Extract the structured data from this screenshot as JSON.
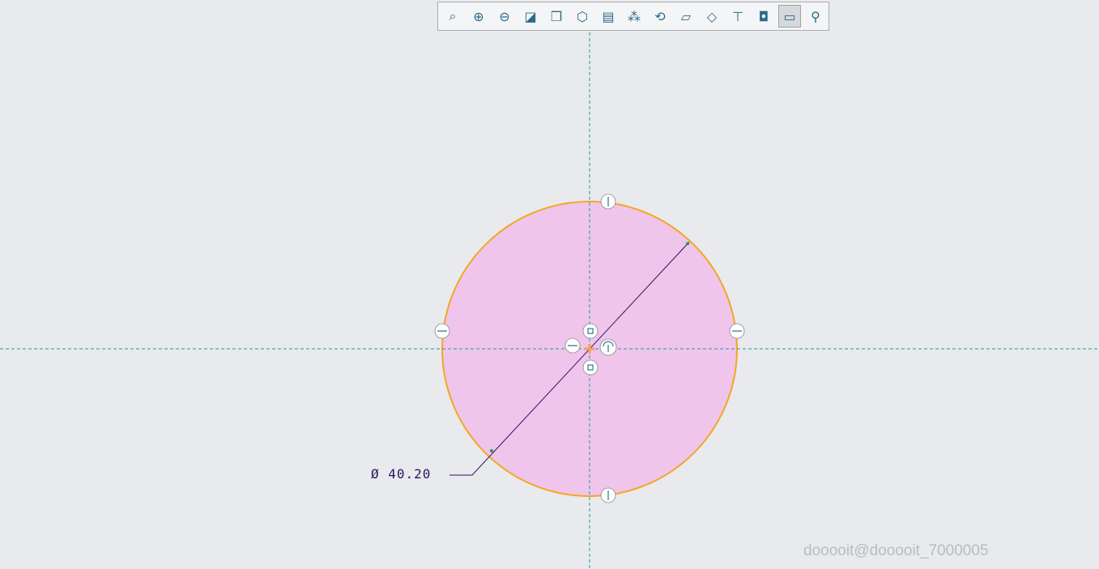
{
  "toolbar": {
    "items": [
      {
        "name": "refit-icon",
        "glyph": "⌕"
      },
      {
        "name": "zoom-in-icon",
        "glyph": "⊕"
      },
      {
        "name": "zoom-out-icon",
        "glyph": "⊖"
      },
      {
        "name": "repaint-icon",
        "glyph": "◪"
      },
      {
        "name": "display-style-icon",
        "glyph": "❒"
      },
      {
        "name": "saved-orientations-icon",
        "glyph": "⬡"
      },
      {
        "name": "view-manager-icon",
        "glyph": "▤"
      },
      {
        "name": "datum-display-icon",
        "glyph": "⁂"
      },
      {
        "name": "spin-center-icon",
        "glyph": "⟲"
      },
      {
        "name": "shaded-icon",
        "glyph": "▱"
      },
      {
        "name": "wireframe-icon",
        "glyph": "◇"
      },
      {
        "name": "annotation-display-icon",
        "glyph": "⊤"
      },
      {
        "name": "sketch-display-icon",
        "glyph": "◘"
      },
      {
        "name": "sketch-view-icon",
        "glyph": "▭"
      },
      {
        "name": "constraints-display-icon",
        "glyph": "⚲"
      }
    ],
    "active_index": 13
  },
  "dimension": {
    "label": "Ø 40.20"
  },
  "watermark": "dooooit@dooooit_7000005",
  "colors": {
    "fill": "#efc3ec",
    "outline": "#f5a623",
    "centerline": "#1f9e8e",
    "dimension": "#2a1660"
  }
}
